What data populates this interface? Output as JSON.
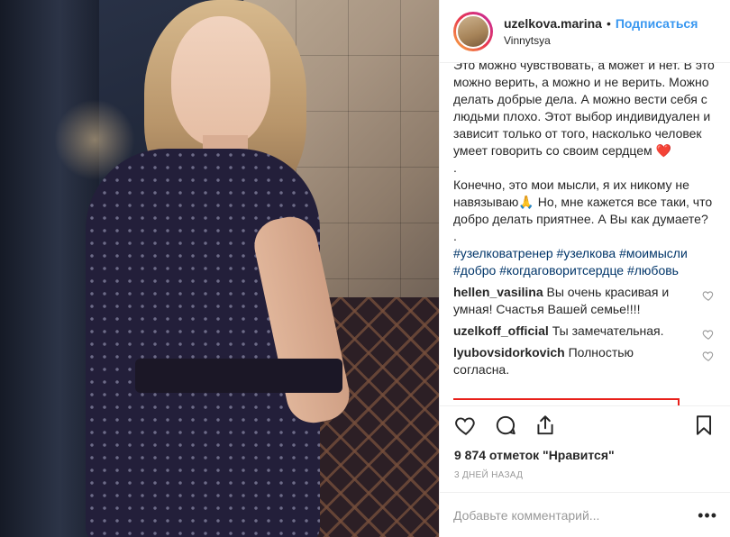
{
  "post": {
    "username": "uzelkova.marina",
    "follow_label": "Подписаться",
    "separator": "•",
    "location": "Vinnytsya"
  },
  "caption": {
    "text": "Это можно чувствовать, а может и нет. В это можно верить, а можно и не верить. Можно делать добрые дела. А можно вести себя с людьми плохо. Этот выбор индивидуален и зависит только от того, насколько человек умеет говорить со своим сердцем ❤️\n.\nКонечно, это мои мысли, я их никому не навязываю🙏 Но, мне кажется все таки, что добро делать приятнее. А Вы как думаете?\n.",
    "hashtags": "#узелковатренер #узелкова #моимысли #добро #когдаговоритсердце #любовь"
  },
  "comments": [
    {
      "user": "hellen_vasilina",
      "text": "Вы очень красивая и умная! Счастья Вашей семье!!!!"
    },
    {
      "user": "uzelkoff_official",
      "text": "Ты замечательная."
    },
    {
      "user": "lyubovsidorkovich",
      "text": "Полностью согласна."
    }
  ],
  "likes_text": "9 874 отметок \"Нравится\"",
  "time_ago": "3 ДНЕЙ НАЗАД",
  "add_comment": {
    "placeholder": "Добавьте комментарий...",
    "more_label": "•••"
  },
  "icons": {
    "like": "heart-icon",
    "comment": "speech-bubble-icon",
    "share": "share-icon",
    "save": "bookmark-icon"
  },
  "colors": {
    "follow": "#3897f0",
    "hashtag": "#003569",
    "highlight_box": "#e8201a",
    "muted": "#999999"
  }
}
